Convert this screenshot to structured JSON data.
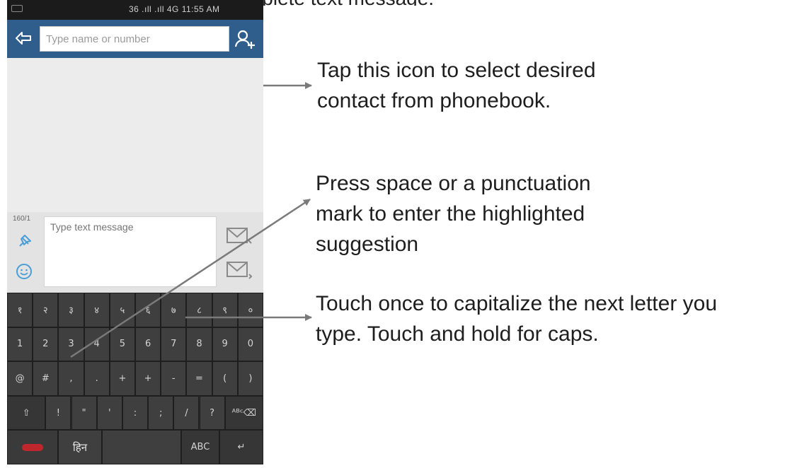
{
  "top_caption": "...ing, ... complete text message.",
  "status_bar": {
    "text": "36 .ıll .ıll 4G 11:55 AM"
  },
  "compose_screen": {
    "to_field_placeholder": "Type name or number",
    "message_placeholder": "Type text message",
    "char_counter": "160/1"
  },
  "keyboard": {
    "row1": [
      "१",
      "२",
      "३",
      "४",
      "५",
      "६",
      "७",
      "८",
      "९",
      "०"
    ],
    "row2": [
      "1",
      "2",
      "3",
      "4",
      "5",
      "6",
      "7",
      "8",
      "9",
      "0"
    ],
    "row3": [
      "@",
      "#",
      ",",
      ".",
      "+",
      "+",
      "-",
      "=",
      "(",
      ")"
    ],
    "row4": [
      "!",
      "\"",
      "'",
      ":",
      ";",
      "/",
      "?"
    ],
    "row4_end": "ᴬᴮᶜ⌫",
    "lang_label": "हिन",
    "shift_label": "⇧",
    "mode_label": "ABC",
    "enter_label": "↵"
  },
  "callouts": {
    "contact": [
      "Tap this icon to select desired",
      "contact from phonebook."
    ],
    "suggestion": [
      "Press space or a punctuation",
      "mark to enter the highlighted",
      "suggestion"
    ],
    "shift": [
      "Touch once to capitalize the next letter you",
      "type. Touch and hold for caps."
    ]
  },
  "colors": {
    "header": "#2f5d8c",
    "keyboard": "#2b2b2b",
    "arrow": "#7a7a7a"
  }
}
